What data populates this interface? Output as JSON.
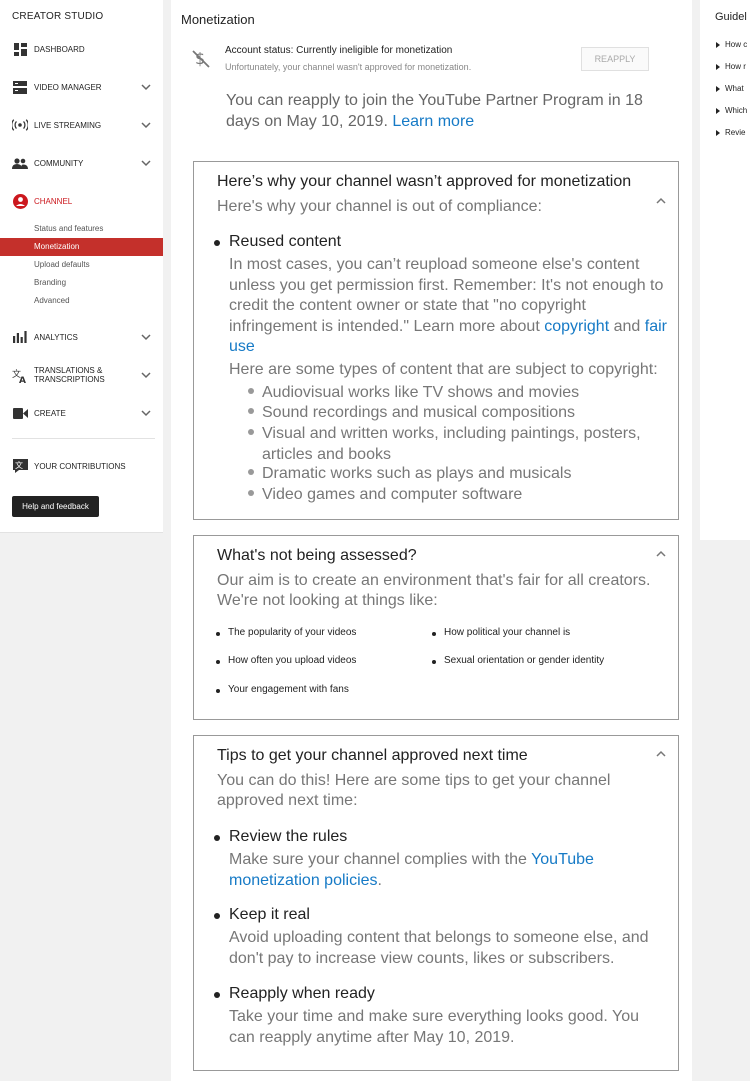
{
  "sidebar": {
    "title": "CREATOR STUDIO",
    "items": [
      {
        "label": "DASHBOARD",
        "icon": "dashboard-icon"
      },
      {
        "label": "VIDEO MANAGER",
        "icon": "video-manager-icon"
      },
      {
        "label": "LIVE STREAMING",
        "icon": "live-streaming-icon"
      },
      {
        "label": "COMMUNITY",
        "icon": "community-icon"
      },
      {
        "label": "CHANNEL",
        "icon": "channel-icon"
      },
      {
        "label": "ANALYTICS",
        "icon": "analytics-icon"
      },
      {
        "label": "TRANSLATIONS & TRANSCRIPTIONS",
        "icon": "translate-icon"
      },
      {
        "label": "CREATE",
        "icon": "create-icon"
      },
      {
        "label": "YOUR CONTRIBUTIONS",
        "icon": "contributions-icon"
      }
    ],
    "channel_sub": [
      "Status and features",
      "Monetization",
      "Upload defaults",
      "Branding",
      "Advanced"
    ],
    "help_button": "Help and feedback"
  },
  "main": {
    "title": "Monetization",
    "status_line1": "Account status: Currently ineligible for monetization",
    "status_line2": "Unfortunately, your channel wasn't approved for monetization.",
    "reapply_button": "REAPPLY",
    "reapply_text": "You can reapply to join the YouTube Partner Program in 18 days on May 10, 2019.",
    "learn_more": "Learn more",
    "card1": {
      "heading": "Here’s why your channel wasn’t approved for monetization",
      "sub": "Here's why your channel is out of compliance:",
      "bullet_title": "Reused content",
      "body": "In most cases, you can’t reupload someone else's content unless you get permission first. Remember: It's not enough to credit the content owner or state that \"no copyright infringement is intended.\" Learn more about",
      "link_copyright": "copyright",
      "and": "and",
      "link_fairuse": "fair use",
      "types_intro": "Here are some types of content that are subject to copyright:",
      "types": [
        "Audiovisual works like TV shows and movies",
        "Sound recordings and musical compositions",
        "Visual and written works, including paintings, posters, articles and books",
        "Dramatic works such as plays and musicals",
        "Video games and computer software"
      ]
    },
    "card2": {
      "heading": "What's not being assessed?",
      "sub": "Our aim is to create an environment that's fair for all creators. We're not looking at things like:",
      "items": [
        "The popularity of your videos",
        "How political your channel is",
        "How often you upload videos",
        "Sexual orientation or gender identity",
        "Your engagement with fans"
      ]
    },
    "card3": {
      "heading": "Tips to get your channel approved next time",
      "sub": "You can do this! Here are some tips to get your channel approved next time:",
      "tips": [
        {
          "title": "Review the rules",
          "body": "Make sure your channel complies with the",
          "link": "YouTube monetization policies",
          "after": "."
        },
        {
          "title": "Keep it real",
          "body": "Avoid uploading content that belongs to someone else, and don't pay to increase view counts, likes or subscribers."
        },
        {
          "title": "Reapply when ready",
          "body": "Take your time and make sure everything looks good. You can reapply anytime after May 10, 2019."
        }
      ]
    }
  },
  "right_panel": {
    "title": "Guidel",
    "items": [
      "How c",
      "How r",
      "What",
      "Which",
      "Revie"
    ]
  },
  "colors": {
    "accent": "#cc181e",
    "selected_bg": "#c4302b",
    "link": "#167ac6"
  }
}
